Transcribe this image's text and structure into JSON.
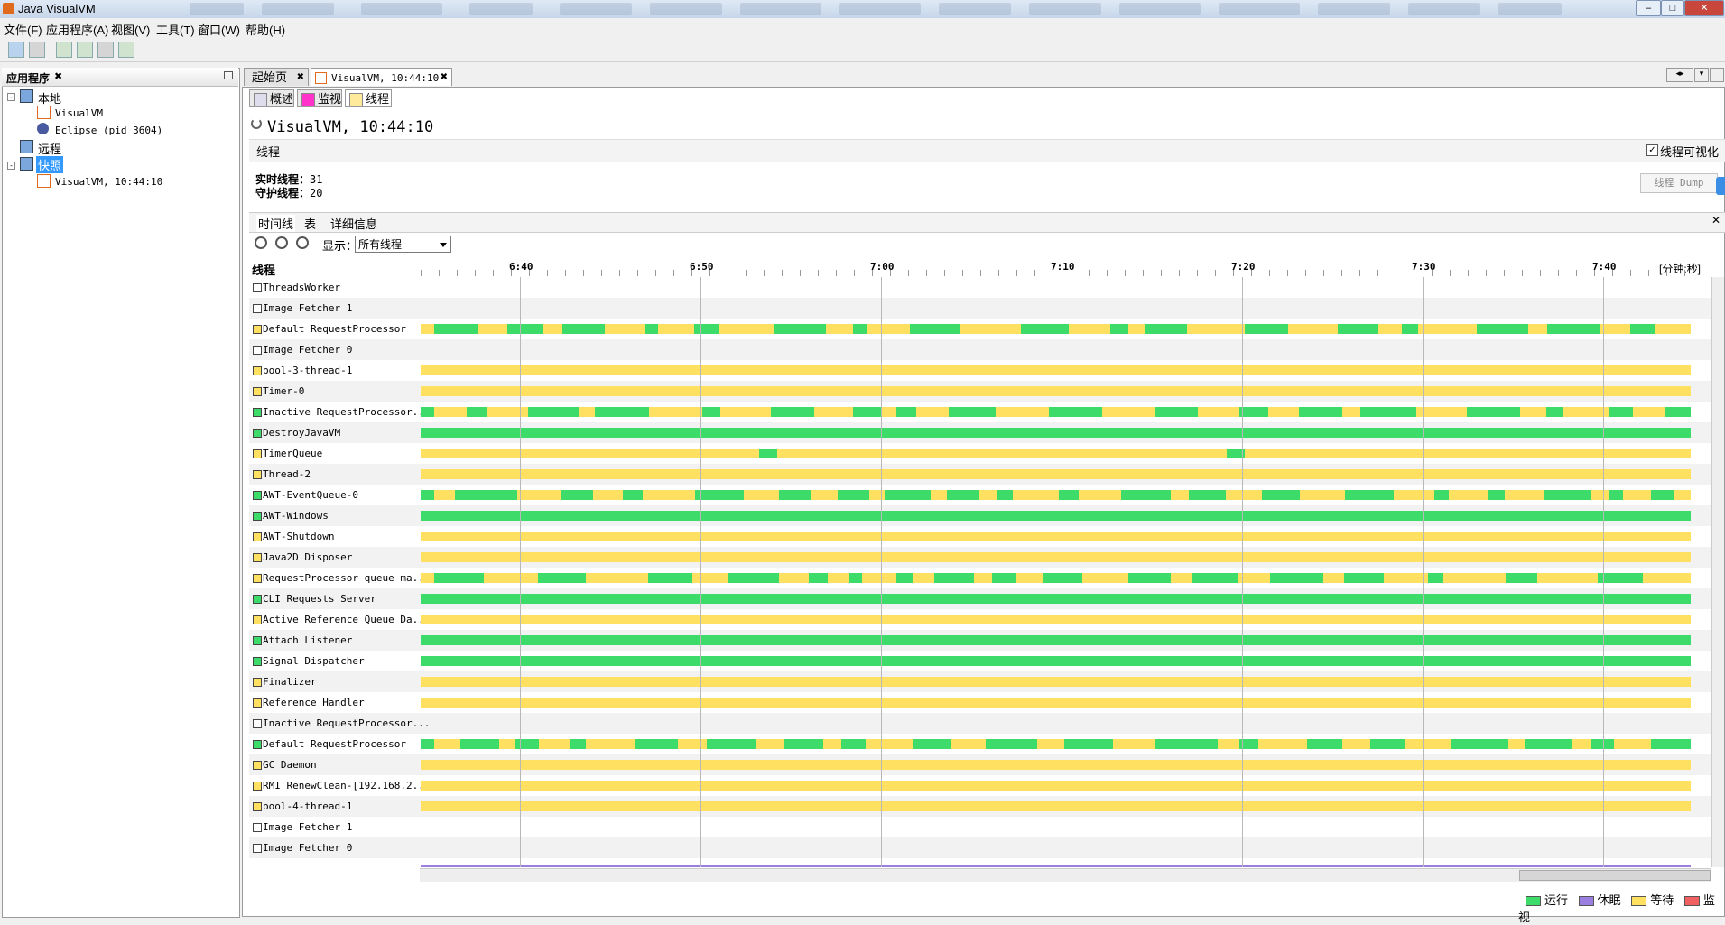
{
  "window": {
    "title": "Java VisualVM",
    "controls": [
      "minimize",
      "maximize",
      "close"
    ]
  },
  "menu": [
    "文件(F)",
    "应用程序(A)",
    "视图(V)",
    "工具(T)",
    "窗口(W)",
    "帮助(H)"
  ],
  "toolbar_icons": [
    "add-jmx-icon",
    "add-host-icon",
    "application-snapshot-icon",
    "heap-dump-icon",
    "thread-dump-icon",
    "snapshot-icon"
  ],
  "left_panel": {
    "header": "应用程序",
    "tree": [
      {
        "label": "本地",
        "icon": "computer-icon",
        "depth": 0
      },
      {
        "label": "VisualVM",
        "icon": "java-app-icon",
        "depth": 1
      },
      {
        "label": "Eclipse (pid 3604)",
        "icon": "eclipse-icon",
        "depth": 1
      },
      {
        "label": "远程",
        "icon": "network-icon",
        "depth": 0
      },
      {
        "label": "快照",
        "icon": "snapshots-icon",
        "depth": 0,
        "selected": true
      },
      {
        "label": "VisualVM, 10:44:10",
        "icon": "snapshot-file-icon",
        "depth": 1
      }
    ]
  },
  "doc_tabs": [
    {
      "label": "起始页"
    },
    {
      "label": "VisualVM, 10:44:10",
      "active": true
    }
  ],
  "sub_tabs": [
    {
      "label": "概述"
    },
    {
      "label": "监视"
    },
    {
      "label": "线程",
      "active": true
    }
  ],
  "page_title": "VisualVM, 10:44:10",
  "section_title": "线程",
  "visualize_checkbox": "线程可视化",
  "counts": {
    "live_label": "实时线程：",
    "live": "31",
    "daemon_label": "守护线程：",
    "daemon": "20"
  },
  "dump_button": "线程 Dump",
  "view_tabs": [
    "时间线",
    "表",
    "详细信息"
  ],
  "display_label": "显示：",
  "display_select": "所有线程",
  "timeline": {
    "column_label": "线程",
    "time_ticks": [
      "6:40",
      "6:50",
      "7:00",
      "7:10",
      "7:20",
      "7:30",
      "7:40"
    ],
    "unit_label": "[分钟:秒]",
    "threads": [
      {
        "name": "ThreadsWorker",
        "state": "none"
      },
      {
        "name": "Image Fetcher 1",
        "state": "none"
      },
      {
        "name": "Default RequestProcessor",
        "state": "wait",
        "pattern": "mixed1"
      },
      {
        "name": "Image Fetcher 0",
        "state": "none"
      },
      {
        "name": "pool-3-thread-1",
        "state": "wait"
      },
      {
        "name": "Timer-0",
        "state": "wait"
      },
      {
        "name": "Inactive RequestProcessor...",
        "state": "run",
        "pattern": "mixed2"
      },
      {
        "name": "DestroyJavaVM",
        "state": "run"
      },
      {
        "name": "TimerQueue",
        "state": "wait",
        "pattern": "sparse"
      },
      {
        "name": "Thread-2",
        "state": "wait"
      },
      {
        "name": "AWT-EventQueue-0",
        "state": "run",
        "pattern": "mixed3"
      },
      {
        "name": "AWT-Windows",
        "state": "run"
      },
      {
        "name": "AWT-Shutdown",
        "state": "wait"
      },
      {
        "name": "Java2D Disposer",
        "state": "wait"
      },
      {
        "name": "RequestProcessor queue ma...",
        "state": "wait",
        "pattern": "mixed4"
      },
      {
        "name": "CLI Requests Server",
        "state": "run"
      },
      {
        "name": "Active Reference Queue Da...",
        "state": "wait"
      },
      {
        "name": "Attach Listener",
        "state": "run"
      },
      {
        "name": "Signal Dispatcher",
        "state": "run"
      },
      {
        "name": "Finalizer",
        "state": "wait"
      },
      {
        "name": "Reference Handler",
        "state": "wait"
      },
      {
        "name": "Inactive RequestProcessor...",
        "state": "none"
      },
      {
        "name": "Default RequestProcessor",
        "state": "run",
        "pattern": "mixed5"
      },
      {
        "name": "GC Daemon",
        "state": "wait"
      },
      {
        "name": "RMI RenewClean-[192.168.2...",
        "state": "wait"
      },
      {
        "name": "pool-4-thread-1",
        "state": "wait"
      },
      {
        "name": "Image Fetcher 1",
        "state": "none"
      },
      {
        "name": "Image Fetcher 0",
        "state": "none"
      }
    ]
  },
  "legend": [
    {
      "label": "运行",
      "color": "#3ddc6a"
    },
    {
      "label": "休眠",
      "color": "#9b7fe0"
    },
    {
      "label": "等待",
      "color": "#ffe060"
    },
    {
      "label": "监视",
      "color": "#f06060"
    }
  ],
  "colors": {
    "run": "#3ddc6a",
    "wait": "#ffe060",
    "sleep": "#9b7fe0",
    "monitor": "#f06060"
  }
}
